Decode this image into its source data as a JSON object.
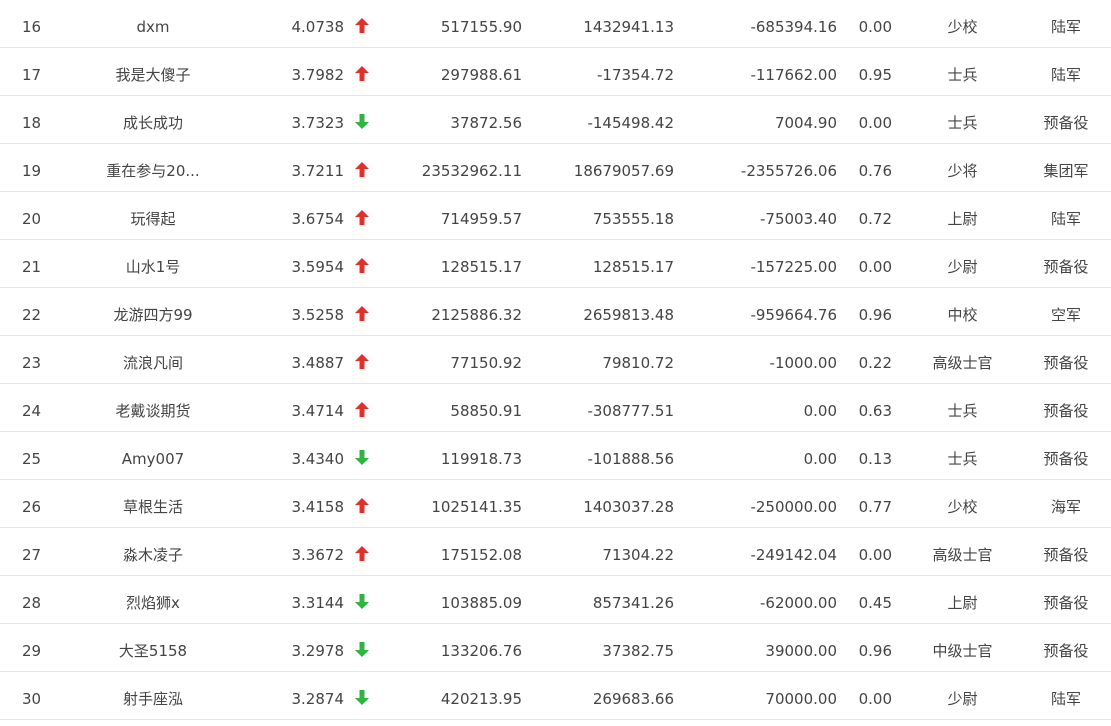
{
  "colors": {
    "up": "#e0302b",
    "down": "#2fb53f",
    "text": "#444444",
    "divider": "#e6e6e6"
  },
  "rows": [
    {
      "rank": "16",
      "name": "dxm",
      "score": "4.0738",
      "trend": "up",
      "v1": "517155.90",
      "v2": "1432941.13",
      "v3": "-685394.16",
      "ratio": "0.00",
      "title": "少校",
      "branch": "陆军"
    },
    {
      "rank": "17",
      "name": "我是大傻子",
      "score": "3.7982",
      "trend": "up",
      "v1": "297988.61",
      "v2": "-17354.72",
      "v3": "-117662.00",
      "ratio": "0.95",
      "title": "士兵",
      "branch": "陆军"
    },
    {
      "rank": "18",
      "name": "成长成功",
      "score": "3.7323",
      "trend": "down",
      "v1": "37872.56",
      "v2": "-145498.42",
      "v3": "7004.90",
      "ratio": "0.00",
      "title": "士兵",
      "branch": "预备役"
    },
    {
      "rank": "19",
      "name": "重在参与20...",
      "score": "3.7211",
      "trend": "up",
      "v1": "23532962.11",
      "v2": "18679057.69",
      "v3": "-2355726.06",
      "ratio": "0.76",
      "title": "少将",
      "branch": "集团军"
    },
    {
      "rank": "20",
      "name": "玩得起",
      "score": "3.6754",
      "trend": "up",
      "v1": "714959.57",
      "v2": "753555.18",
      "v3": "-75003.40",
      "ratio": "0.72",
      "title": "上尉",
      "branch": "陆军"
    },
    {
      "rank": "21",
      "name": "山水1号",
      "score": "3.5954",
      "trend": "up",
      "v1": "128515.17",
      "v2": "128515.17",
      "v3": "-157225.00",
      "ratio": "0.00",
      "title": "少尉",
      "branch": "预备役"
    },
    {
      "rank": "22",
      "name": "龙游四方99",
      "score": "3.5258",
      "trend": "up",
      "v1": "2125886.32",
      "v2": "2659813.48",
      "v3": "-959664.76",
      "ratio": "0.96",
      "title": "中校",
      "branch": "空军"
    },
    {
      "rank": "23",
      "name": "流浪凡间",
      "score": "3.4887",
      "trend": "up",
      "v1": "77150.92",
      "v2": "79810.72",
      "v3": "-1000.00",
      "ratio": "0.22",
      "title": "高级士官",
      "branch": "预备役"
    },
    {
      "rank": "24",
      "name": "老戴谈期货",
      "score": "3.4714",
      "trend": "up",
      "v1": "58850.91",
      "v2": "-308777.51",
      "v3": "0.00",
      "ratio": "0.63",
      "title": "士兵",
      "branch": "预备役"
    },
    {
      "rank": "25",
      "name": "Amy007",
      "score": "3.4340",
      "trend": "down",
      "v1": "119918.73",
      "v2": "-101888.56",
      "v3": "0.00",
      "ratio": "0.13",
      "title": "士兵",
      "branch": "预备役"
    },
    {
      "rank": "26",
      "name": "草根生活",
      "score": "3.4158",
      "trend": "up",
      "v1": "1025141.35",
      "v2": "1403037.28",
      "v3": "-250000.00",
      "ratio": "0.77",
      "title": "少校",
      "branch": "海军"
    },
    {
      "rank": "27",
      "name": "淼木凌子",
      "score": "3.3672",
      "trend": "up",
      "v1": "175152.08",
      "v2": "71304.22",
      "v3": "-249142.04",
      "ratio": "0.00",
      "title": "高级士官",
      "branch": "预备役"
    },
    {
      "rank": "28",
      "name": "烈焰狮x",
      "score": "3.3144",
      "trend": "down",
      "v1": "103885.09",
      "v2": "857341.26",
      "v3": "-62000.00",
      "ratio": "0.45",
      "title": "上尉",
      "branch": "预备役"
    },
    {
      "rank": "29",
      "name": "大圣5158",
      "score": "3.2978",
      "trend": "down",
      "v1": "133206.76",
      "v2": "37382.75",
      "v3": "39000.00",
      "ratio": "0.96",
      "title": "中级士官",
      "branch": "预备役"
    },
    {
      "rank": "30",
      "name": "射手座泓",
      "score": "3.2874",
      "trend": "down",
      "v1": "420213.95",
      "v2": "269683.66",
      "v3": "70000.00",
      "ratio": "0.00",
      "title": "少尉",
      "branch": "陆军"
    }
  ]
}
